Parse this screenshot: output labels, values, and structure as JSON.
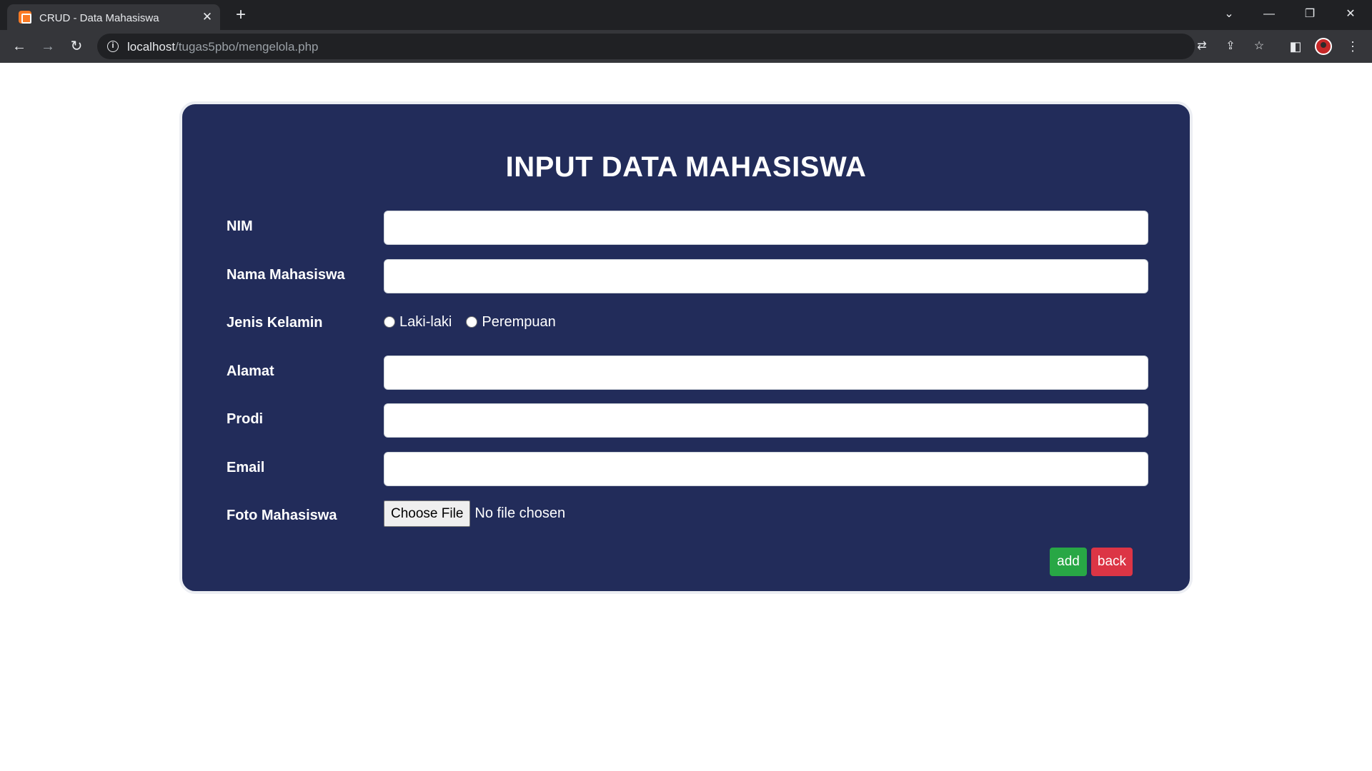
{
  "browser": {
    "tab_title": "CRUD - Data Mahasiswa",
    "url_host": "localhost",
    "url_path": "/tugas5pbo/mengelola.php"
  },
  "form": {
    "title": "INPUT DATA MAHASISWA",
    "fields": {
      "nim": {
        "label": "NIM",
        "value": ""
      },
      "nama": {
        "label": "Nama Mahasiswa",
        "value": ""
      },
      "jenis_kelamin": {
        "label": "Jenis Kelamin",
        "options": [
          "Laki-laki",
          "Perempuan"
        ],
        "selected": null
      },
      "alamat": {
        "label": "Alamat",
        "value": ""
      },
      "prodi": {
        "label": "Prodi",
        "value": ""
      },
      "email": {
        "label": "Email",
        "value": ""
      },
      "foto": {
        "label": "Foto Mahasiswa",
        "button_label": "Choose File",
        "status": "No file chosen"
      }
    },
    "buttons": {
      "add_label": "add",
      "back_label": "back"
    }
  },
  "colors": {
    "card_background": "#222c5a",
    "add_button": "#28a745",
    "back_button": "#dc3545"
  }
}
